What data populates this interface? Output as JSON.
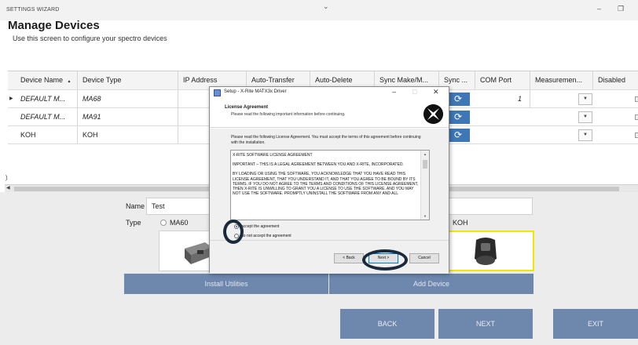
{
  "window": {
    "title": "SETTINGS WIZARD"
  },
  "page": {
    "title": "Manage Devices",
    "subtitle": "Use this screen to configure your spectro devices",
    "stray_glyph": ")"
  },
  "grid": {
    "columns": [
      "Device Name",
      "Device Type",
      "IP Address",
      "Auto-Transfer",
      "Auto-Delete",
      "Sync Make/M...",
      "Sync ...",
      "COM Port",
      "Measuremen...",
      "Disabled"
    ],
    "sort_indicator": "▲",
    "rows": [
      {
        "name": "DEFAULT M...",
        "type": "MA68",
        "com": "1",
        "italic": true,
        "selected": true
      },
      {
        "name": "DEFAULT M...",
        "type": "MA91",
        "com": "",
        "italic": true,
        "selected": false
      },
      {
        "name": "KOH",
        "type": "KOH",
        "com": "",
        "italic": false,
        "selected": false
      }
    ]
  },
  "detail": {
    "name_label": "Name",
    "name_value": "Test",
    "type_label": "Type",
    "type_options": [
      "MA60",
      "KOH"
    ]
  },
  "buttons": {
    "install_utilities": "Install Utilities",
    "add_device": "Add Device",
    "back": "BACK",
    "next": "NEXT",
    "exit": "EXIT"
  },
  "dialog": {
    "title": "Setup - X-Rite MATX3x Driver",
    "heading": "License Agreement",
    "subheading": "Please read the following important information before continuing.",
    "instruction": "Please read the following License Agreement. You must accept the terms of this agreement before continuing with the installation.",
    "license_paragraphs": [
      "X-RITE SOFTWARE LICENSE AGREEMENT",
      "IMPORTANT – THIS IS A LEGAL AGREEMENT BETWEEN YOU AND X-RITE, INCORPORATED.",
      "BY LOADING OR USING THE SOFTWARE, YOU ACKNOWLEDGE THAT YOU HAVE READ THIS LICENSE AGREEMENT, THAT YOU UNDERSTAND IT, AND THAT YOU AGREE TO BE BOUND BY ITS TERMS. IF YOU DO NOT AGREE TO THE TERMS AND CONDITIONS OF THIS LICENSE AGREEMENT, THEN X-RITE IS UNWILLING TO GRANT YOU A LICENSE TO USE THE SOFTWARE, AND YOU MAY NOT USE THE SOFTWARE. PROMPTLY UNINSTALL THE SOFTWARE FROM ANY AND ALL"
    ],
    "accept_label": "accept the agreement",
    "decline_label": "do not accept the agreement",
    "back_button": "< Back",
    "next_button": "Next >",
    "cancel_button": "Cancel"
  },
  "colors": {
    "accent_blue": "#3f76b5",
    "button_slate": "#6d87ad",
    "highlight_yellow": "#f1e800",
    "annotation_ring": "#1b2a3a"
  }
}
